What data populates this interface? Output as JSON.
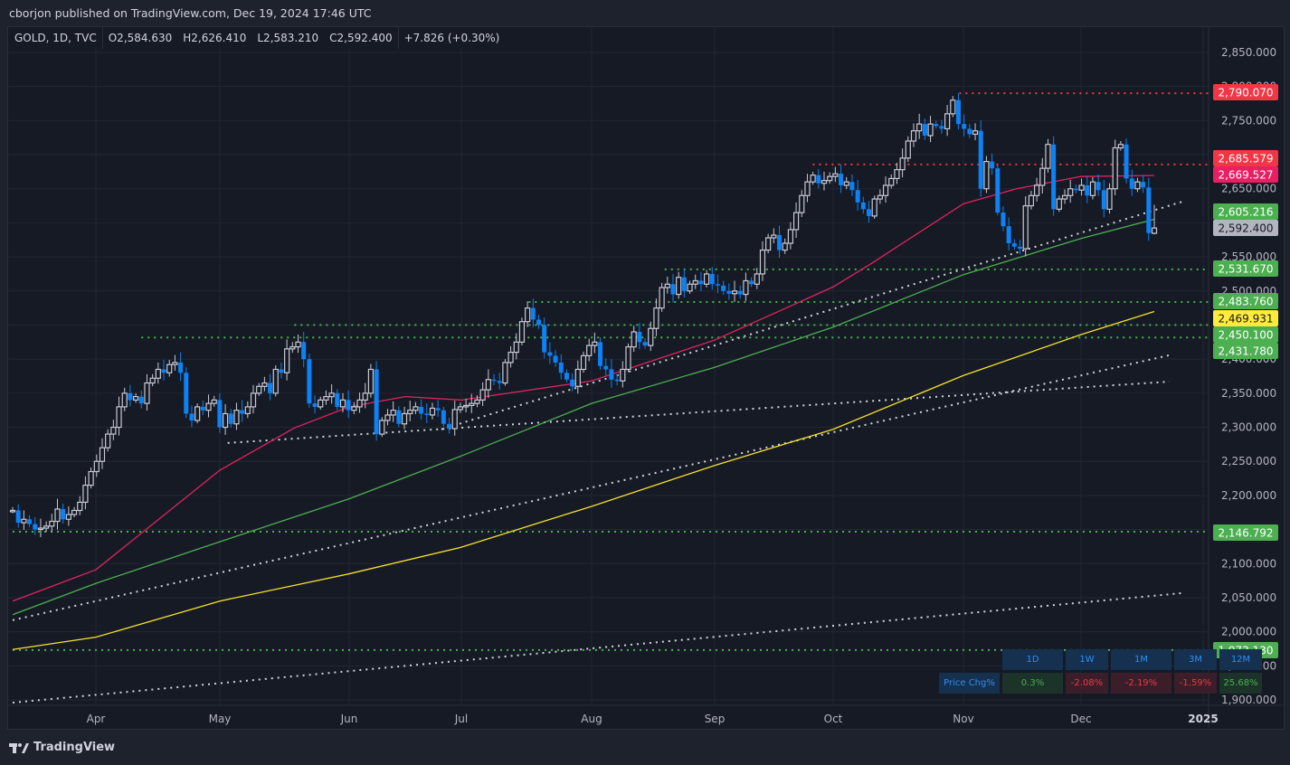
{
  "published_line": "cborjon published on TradingView.com, Dec 19, 2024 17:46 UTC",
  "legend": {
    "symbol": "GOLD, 1D, TVC",
    "open": "O2,584.630",
    "high": "H2,626.410",
    "low": "L2,583.210",
    "close": "C2,592.400",
    "change": "+7.826 (+0.30%)"
  },
  "footer": {
    "logo_text": "TradingView"
  },
  "colors": {
    "background": "#161a25",
    "up_candle": "#c8cad3",
    "down_candle": "#0d82f5",
    "ma_red": "#e0245e",
    "ma_green": "#4caf50",
    "ma_yellow": "#f5e12a",
    "level_red": "#f23645",
    "level_green": "#4caf50",
    "trendline": "#d1d4dc"
  },
  "chart_data": {
    "type": "candlestick",
    "symbol": "GOLD",
    "interval": "1D",
    "source": "TVC",
    "last_bar": {
      "date": "Dec 19, 2024",
      "open": 2584.63,
      "high": 2626.41,
      "low": 2583.21,
      "close": 2592.4
    },
    "closes": [
      2178,
      2160,
      2165,
      2158,
      2150,
      2152,
      2155,
      2162,
      2180,
      2165,
      2172,
      2178,
      2190,
      2215,
      2235,
      2250,
      2270,
      2290,
      2300,
      2330,
      2350,
      2340,
      2345,
      2335,
      2365,
      2372,
      2385,
      2380,
      2392,
      2395,
      2380,
      2320,
      2310,
      2330,
      2325,
      2335,
      2340,
      2300,
      2320,
      2305,
      2325,
      2320,
      2330,
      2350,
      2360,
      2365,
      2350,
      2385,
      2380,
      2415,
      2418,
      2425,
      2400,
      2335,
      2330,
      2340,
      2345,
      2350,
      2330,
      2340,
      2325,
      2330,
      2340,
      2350,
      2385,
      2290,
      2310,
      2318,
      2325,
      2305,
      2320,
      2325,
      2330,
      2320,
      2318,
      2328,
      2325,
      2305,
      2298,
      2326,
      2330,
      2332,
      2335,
      2340,
      2355,
      2370,
      2368,
      2365,
      2395,
      2410,
      2425,
      2455,
      2475,
      2458,
      2450,
      2410,
      2405,
      2395,
      2380,
      2370,
      2360,
      2385,
      2405,
      2420,
      2425,
      2390,
      2385,
      2370,
      2368,
      2385,
      2418,
      2440,
      2425,
      2420,
      2445,
      2475,
      2505,
      2510,
      2495,
      2520,
      2500,
      2510,
      2515,
      2510,
      2525,
      2510,
      2508,
      2500,
      2496,
      2500,
      2495,
      2515,
      2510,
      2525,
      2560,
      2578,
      2582,
      2560,
      2570,
      2590,
      2615,
      2640,
      2660,
      2670,
      2658,
      2662,
      2668,
      2672,
      2655,
      2660,
      2648,
      2630,
      2620,
      2610,
      2635,
      2640,
      2655,
      2665,
      2678,
      2695,
      2720,
      2735,
      2745,
      2728,
      2745,
      2742,
      2738,
      2760,
      2780,
      2745,
      2738,
      2730,
      2735,
      2650,
      2690,
      2680,
      2615,
      2595,
      2570,
      2565,
      2562,
      2625,
      2640,
      2655,
      2680,
      2715,
      2620,
      2635,
      2640,
      2650,
      2648,
      2655,
      2640,
      2660,
      2648,
      2620,
      2650,
      2710,
      2715,
      2665,
      2650,
      2660,
      2652,
      2585,
      2592.4
    ],
    "moving_averages": [
      {
        "color": "#e0245e",
        "points": [
          [
            "2024-03-08",
            2045
          ],
          [
            "2024-04-01",
            2091
          ],
          [
            "2024-05-01",
            2237
          ],
          [
            "2024-05-20",
            2299
          ],
          [
            "2024-06-03",
            2330
          ],
          [
            "2024-06-17",
            2345
          ],
          [
            "2024-07-01",
            2340
          ],
          [
            "2024-08-01",
            2368
          ],
          [
            "2024-09-02",
            2428
          ],
          [
            "2024-10-01",
            2506
          ],
          [
            "2024-10-10",
            2540
          ],
          [
            "2024-11-01",
            2628
          ],
          [
            "2024-11-15",
            2650
          ],
          [
            "2024-12-02",
            2668
          ],
          [
            "2024-12-19",
            2669.527
          ]
        ]
      },
      {
        "color": "#4caf50",
        "points": [
          [
            "2024-03-08",
            2025
          ],
          [
            "2024-04-01",
            2071
          ],
          [
            "2024-05-01",
            2132
          ],
          [
            "2024-06-03",
            2195
          ],
          [
            "2024-07-01",
            2258
          ],
          [
            "2024-08-01",
            2335
          ],
          [
            "2024-09-02",
            2388
          ],
          [
            "2024-10-01",
            2447
          ],
          [
            "2024-11-01",
            2524
          ],
          [
            "2024-12-02",
            2577
          ],
          [
            "2024-12-19",
            2605.216
          ]
        ]
      },
      {
        "color": "#f5e12a",
        "points": [
          [
            "2024-03-08",
            1974
          ],
          [
            "2024-04-01",
            1992
          ],
          [
            "2024-05-01",
            2045
          ],
          [
            "2024-06-03",
            2085
          ],
          [
            "2024-07-01",
            2124
          ],
          [
            "2024-08-01",
            2184
          ],
          [
            "2024-09-02",
            2244
          ],
          [
            "2024-10-01",
            2297
          ],
          [
            "2024-11-01",
            2376
          ],
          [
            "2024-12-02",
            2436
          ],
          [
            "2024-12-19",
            2469.931
          ]
        ]
      }
    ],
    "trendlines": [
      {
        "from": [
          "2024-03-08",
          1896
        ],
        "to": [
          "2024-12-27",
          2057
        ]
      },
      {
        "from": [
          "2024-03-08",
          2017
        ],
        "to": [
          "2024-12-24",
          2407
        ]
      },
      {
        "from": [
          "2024-05-03",
          2277
        ],
        "to": [
          "2024-12-23",
          2367
        ]
      },
      {
        "from": [
          "2024-06-26",
          2297
        ],
        "to": [
          "2024-12-27",
          2632
        ]
      }
    ],
    "horizontal_levels": [
      {
        "price": 2790.07,
        "label": "2,790.070",
        "color": "#f23645",
        "from": "2024-10-31"
      },
      {
        "price": 2685.579,
        "label": "2,685.579",
        "color": "#f23645",
        "from": "2024-09-26"
      },
      {
        "price": 2531.67,
        "label": "2,531.670",
        "color": "#4caf50",
        "from": "2024-08-20"
      },
      {
        "price": 2483.76,
        "label": "2,483.760",
        "color": "#4caf50",
        "from": "2024-07-17"
      },
      {
        "price": 2450.1,
        "label": "2,450.100",
        "color": "#4caf50",
        "from": "2024-05-20"
      },
      {
        "price": 2431.78,
        "label": "2,431.780",
        "color": "#4caf50",
        "from": "2024-04-12"
      },
      {
        "price": 2146.792,
        "label": "2,146.792",
        "color": "#4caf50",
        "from": "2024-03-08"
      },
      {
        "price": 1973.13,
        "label": "1,973.130",
        "color": "#4caf50",
        "from": "2024-03-08"
      }
    ],
    "price_tags": [
      {
        "label": "2,669.527",
        "bg": "#e91e63",
        "fg": "#ffffff",
        "price": 2669.527
      },
      {
        "label": "2,605.216",
        "bg": "#4caf50",
        "fg": "#ffffff",
        "price": 2605.216
      },
      {
        "label": "2,592.400",
        "bg": "#b2b5be",
        "fg": "#131722",
        "price": 2592.4
      },
      {
        "label": "2,469.931",
        "bg": "#ffeb3b",
        "fg": "#131722",
        "price": 2469.931
      }
    ],
    "y_ticks": [
      "2,850.000",
      "2,800.000",
      "2,750.000",
      "2,700.000",
      "2,650.000",
      "2,600.000",
      "2,550.000",
      "2,500.000",
      "2,450.000",
      "2,400.000",
      "2,350.000",
      "2,300.000",
      "2,250.000",
      "2,200.000",
      "2,150.000",
      "2,100.000",
      "2,050.000",
      "2,000.000",
      "1,950.000",
      "1,900.000"
    ],
    "ylim": [
      1900,
      2850
    ],
    "x_ticks": [
      "Apr",
      "May",
      "Jun",
      "Jul",
      "Aug",
      "Sep",
      "Oct",
      "Nov",
      "Dec",
      "2025"
    ],
    "grid": true
  },
  "perf_table": {
    "periods": [
      "1D",
      "1W",
      "1M",
      "3M",
      "12M"
    ],
    "row_label": "Price Chg%",
    "values": [
      {
        "text": "0.3%",
        "sign": "pos"
      },
      {
        "text": "-2.08%",
        "sign": "neg"
      },
      {
        "text": "-2.19%",
        "sign": "neg"
      },
      {
        "text": "-1.59%",
        "sign": "neg"
      },
      {
        "text": "25.68%",
        "sign": "pos"
      }
    ]
  }
}
